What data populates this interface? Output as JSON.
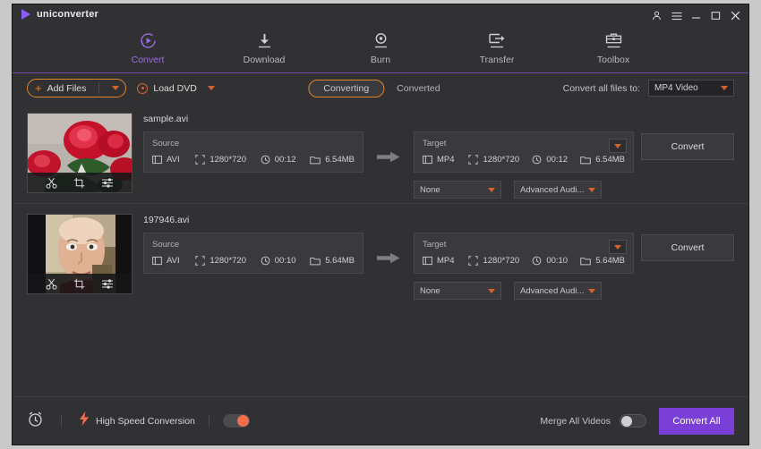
{
  "window": {
    "brand": "uniconverter",
    "controls": [
      {
        "name": "account-icon",
        "glyph": "account"
      },
      {
        "name": "menu-icon",
        "glyph": "menu"
      },
      {
        "name": "minimize-icon",
        "glyph": "minimize"
      },
      {
        "name": "maximize-icon",
        "glyph": "maximize"
      },
      {
        "name": "close-icon",
        "glyph": "close"
      }
    ]
  },
  "nav": {
    "items": [
      {
        "label": "Convert",
        "icon": "convert-icon",
        "active": true
      },
      {
        "label": "Download",
        "icon": "download-icon",
        "active": false
      },
      {
        "label": "Burn",
        "icon": "burn-icon",
        "active": false
      },
      {
        "label": "Transfer",
        "icon": "transfer-icon",
        "active": false
      },
      {
        "label": "Toolbox",
        "icon": "toolbox-icon",
        "active": false
      }
    ]
  },
  "toolbar": {
    "add_files_label": "Add Files",
    "add_files_plus": "+",
    "load_dvd_label": "Load DVD",
    "tabs": [
      {
        "label": "Converting",
        "active": true
      },
      {
        "label": "Converted",
        "active": false
      }
    ],
    "convert_all_to_label": "Convert all files to:",
    "convert_all_to_value": "MP4 Video"
  },
  "files": [
    {
      "name": "sample.avi",
      "thumbnail": "red-roses",
      "tools": [
        "trim-icon",
        "crop-icon",
        "effect-icon"
      ],
      "source": {
        "header": "Source",
        "format": "AVI",
        "resolution": "1280*720",
        "duration": "00:12",
        "size": "6.54MB"
      },
      "target": {
        "header": "Target",
        "format": "MP4",
        "resolution": "1280*720",
        "duration": "00:12",
        "size": "6.54MB"
      },
      "subtitle_option": "None",
      "audio_option": "Advanced Audi...",
      "convert_label": "Convert"
    },
    {
      "name": "197946.avi",
      "thumbnail": "portrait-face",
      "tools": [
        "trim-icon",
        "crop-icon",
        "effect-icon"
      ],
      "source": {
        "header": "Source",
        "format": "AVI",
        "resolution": "1280*720",
        "duration": "00:10",
        "size": "5.64MB"
      },
      "target": {
        "header": "Target",
        "format": "MP4",
        "resolution": "1280*720",
        "duration": "00:10",
        "size": "5.64MB"
      },
      "subtitle_option": "None",
      "audio_option": "Advanced Audi...",
      "convert_label": "Convert"
    }
  ],
  "bottom": {
    "high_speed_label": "High Speed Conversion",
    "high_speed_on": true,
    "merge_label": "Merge All Videos",
    "merge_on": false,
    "convert_all_label": "Convert All"
  },
  "colors": {
    "accent_purple": "#7a3fd6",
    "accent_orange": "#e08428",
    "toggle_on": "#f06f4a",
    "panel_bg": "#313134",
    "window_bg": "#2b2b2e"
  }
}
